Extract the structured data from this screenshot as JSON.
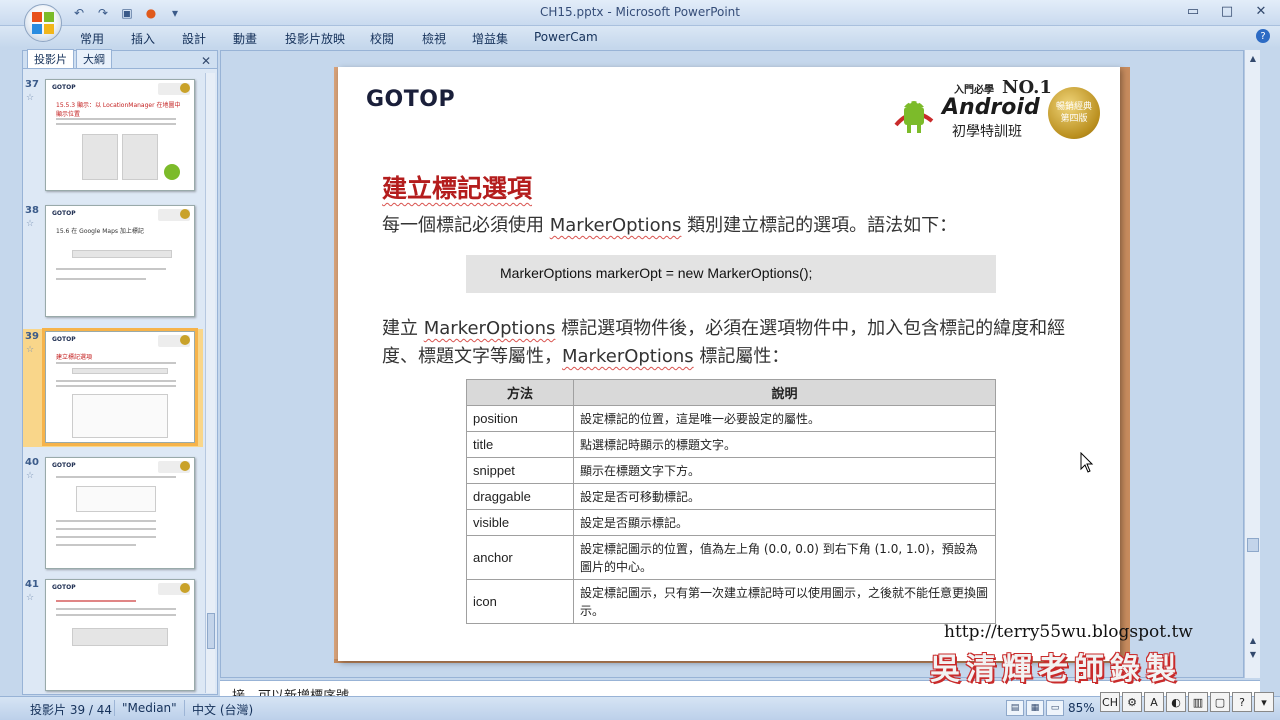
{
  "window": {
    "title": "CH15.pptx - Microsoft PowerPoint"
  },
  "ribbon": {
    "tabs": [
      "常用",
      "插入",
      "設計",
      "動畫",
      "投影片放映",
      "校閱",
      "檢視",
      "增益集",
      "PowerCam"
    ]
  },
  "left_panel": {
    "tabs": [
      "投影片",
      "大綱"
    ],
    "slides": [
      {
        "num": "37",
        "title": "15.5.3 顯示：以 LocationManager 在地圖中顯示位置",
        "selected": false
      },
      {
        "num": "38",
        "title": "15.6 在 Google Maps 加上標記",
        "selected": false
      },
      {
        "num": "39",
        "title": "建立標記選項",
        "selected": true
      },
      {
        "num": "40",
        "title": "",
        "selected": false
      },
      {
        "num": "41",
        "title": "",
        "selected": false
      }
    ]
  },
  "slide": {
    "logo": "GOTOP",
    "brand": {
      "tagline": "入門必學",
      "no1": "NO.1",
      "product": "Android",
      "subtitle": "初學特訓班",
      "seal_line1": "暢銷經典",
      "seal_line2": "第四版"
    },
    "title": "建立標記選項",
    "para1_pre": "每一個標記必須使用 ",
    "para1_class": "MarkerOptions",
    "para1_post": " 類別建立標記的選項。語法如下：",
    "code": "MarkerOptions markerOpt = new MarkerOptions();",
    "para2_pre": "建立 ",
    "para2_class1": "MarkerOptions",
    "para2_mid": " 標記選項物件後，必須在選項物件中，加入包含標記的緯度和經度、標題文字等屬性，",
    "para2_class2": "MarkerOptions",
    "para2_post": " 標記屬性：",
    "table": {
      "headers": [
        "方法",
        "說明"
      ],
      "rows": [
        [
          "position",
          "設定標記的位置，這是唯一必要設定的屬性。"
        ],
        [
          "title",
          "點選標記時顯示的標題文字。"
        ],
        [
          "snippet",
          "顯示在標題文字下方。"
        ],
        [
          "draggable",
          "設定是否可移動標記。"
        ],
        [
          "visible",
          "設定是否顯示標記。"
        ],
        [
          "anchor",
          "設定標記圖示的位置，值為左上角 (0.0, 0.0) 到右下角 (1.0, 1.0)，預設為圖片的中心。"
        ],
        [
          "icon",
          "設定標記圖示，只有第一次建立標記時可以使用圖示，之後就不能任意更換圖示。"
        ]
      ]
    }
  },
  "notes": {
    "text": "接、可以新增標序號"
  },
  "status": {
    "slide_counter": "投影片 39 / 44",
    "theme": "\"Median\"",
    "language": "中文 (台灣)",
    "zoom": "85%"
  },
  "watermark": {
    "url": "http://terry55wu.blogspot.tw",
    "name": "吳清輝老師錄製"
  },
  "colors": {
    "accent_title": "#b41d1d",
    "selected_thumb": "#f6b34a"
  }
}
